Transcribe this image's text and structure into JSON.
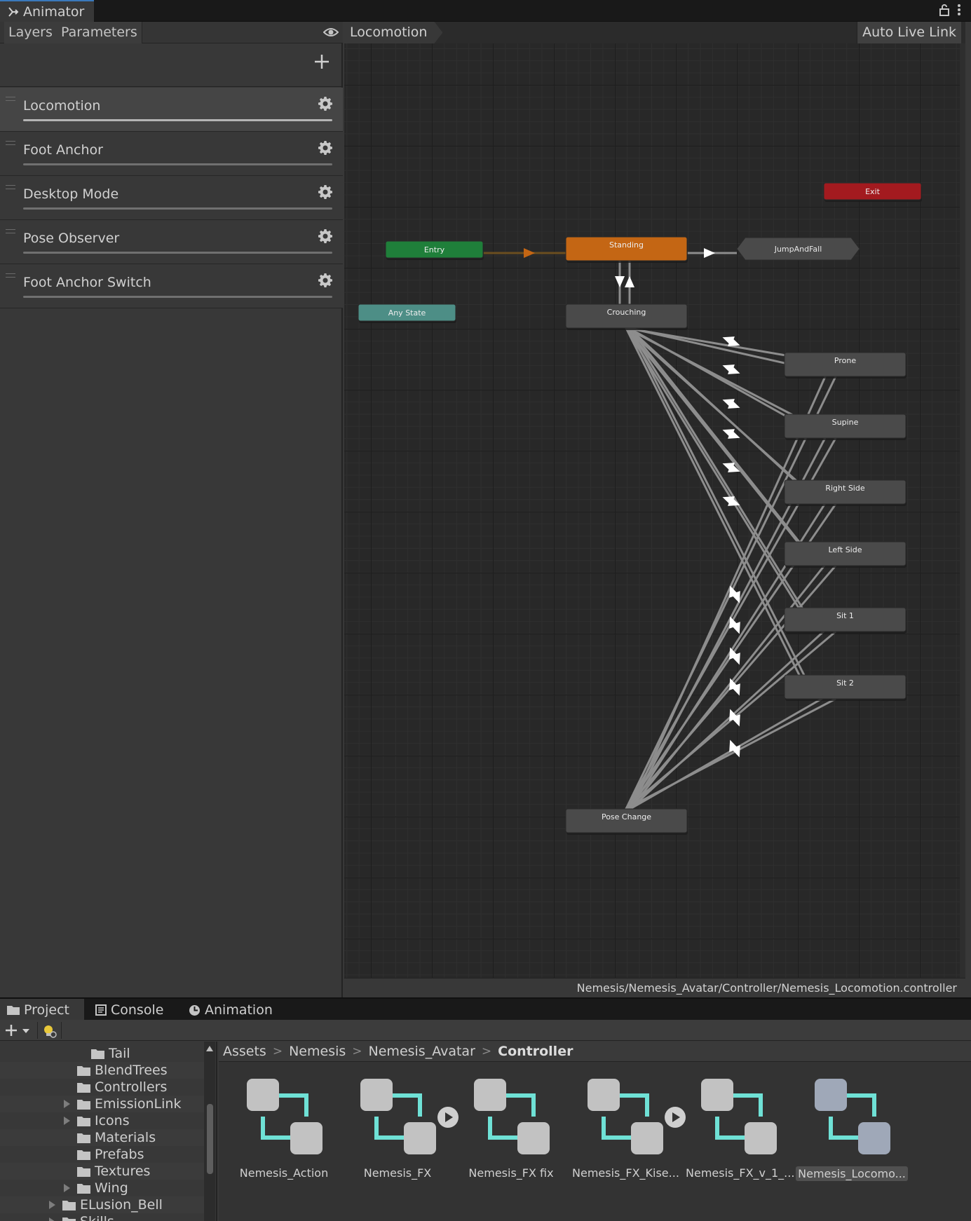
{
  "window": {
    "animator_tab": "Animator",
    "panel_tabs": [
      "Layers",
      "Parameters"
    ]
  },
  "layers": [
    {
      "name": "Locomotion",
      "selected": true
    },
    {
      "name": "Foot Anchor",
      "selected": false
    },
    {
      "name": "Desktop Mode",
      "selected": false
    },
    {
      "name": "Pose Observer",
      "selected": false
    },
    {
      "name": "Foot Anchor Switch",
      "selected": false
    }
  ],
  "graph": {
    "breadcrumb": "Locomotion",
    "auto_live_link": "Auto Live Link",
    "footer_path": "Nemesis/Nemesis_Avatar/Controller/Nemesis_Locomotion.controller",
    "states": {
      "entry": "Entry",
      "exit": "Exit",
      "any_state": "Any State",
      "standing": "Standing",
      "jump_and_fall": "JumpAndFall",
      "crouching": "Crouching",
      "prone": "Prone",
      "supine": "Supine",
      "right_side": "Right Side",
      "left_side": "Left Side",
      "sit1": "Sit 1",
      "sit2": "Sit 2",
      "pose_change": "Pose Change"
    },
    "colors": {
      "entry": "#1f7f3a",
      "exit": "#a31a1f",
      "any_state": "#4d8e86",
      "default_state": "#c46614",
      "state": "#4a4a4a"
    }
  },
  "bottom_tabs": [
    "Project",
    "Console",
    "Animation"
  ],
  "project_tree": [
    {
      "label": "Tail",
      "depth": 3,
      "arrow": false
    },
    {
      "label": "BlendTrees",
      "depth": 2,
      "arrow": false
    },
    {
      "label": "Controllers",
      "depth": 2,
      "arrow": false
    },
    {
      "label": "EmissionLink",
      "depth": 2,
      "arrow": true
    },
    {
      "label": "Icons",
      "depth": 2,
      "arrow": true
    },
    {
      "label": "Materials",
      "depth": 2,
      "arrow": false
    },
    {
      "label": "Prefabs",
      "depth": 2,
      "arrow": false
    },
    {
      "label": "Textures",
      "depth": 2,
      "arrow": false
    },
    {
      "label": "Wing",
      "depth": 2,
      "arrow": true
    },
    {
      "label": "ELusion_Bell",
      "depth": 1,
      "arrow": true
    },
    {
      "label": "Skills",
      "depth": 1,
      "arrow": true
    }
  ],
  "asset_breadcrumb": [
    "Assets",
    "Nemesis",
    "Nemesis_Avatar",
    "Controller"
  ],
  "assets": [
    {
      "label": "Nemesis_Action",
      "play": false,
      "selected": false
    },
    {
      "label": "Nemesis_FX",
      "play": true,
      "selected": false
    },
    {
      "label": "Nemesis_FX fix",
      "play": false,
      "selected": false
    },
    {
      "label": "Nemesis_FX_Kise...",
      "play": true,
      "selected": false
    },
    {
      "label": "Nemesis_FX_v_1_...",
      "play": false,
      "selected": false
    },
    {
      "label": "Nemesis_Locomo...",
      "play": false,
      "selected": true
    }
  ]
}
